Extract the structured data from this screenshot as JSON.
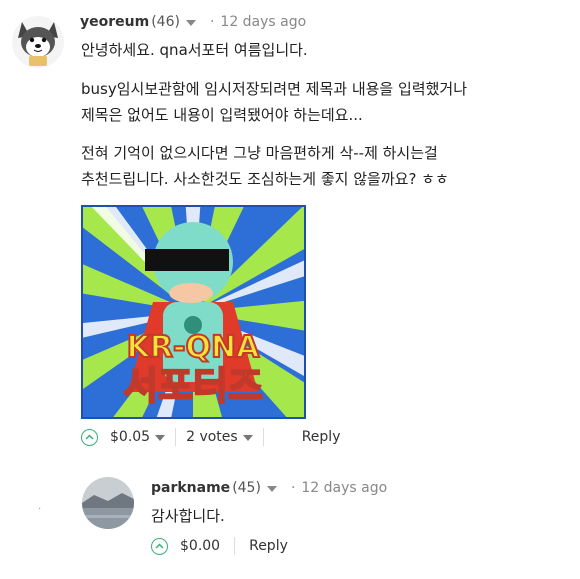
{
  "comments": [
    {
      "author": "yeoreum",
      "reputation": "(46)",
      "time": "12 days ago",
      "paragraphs": [
        "안녕하세요. qna서포터 여름입니다.",
        "busy임시보관함에 임시저장되려면 제목과 내용을 입력했거나",
        "제목은 없어도 내용이 입력됐어야 하는데요...",
        "전혀 기억이 없으시다면 그냥 마음편하게 삭--제 하시는걸",
        "추천드립니다. 사소한것도 조심하는게 좋지 않을까요? ㅎㅎ"
      ],
      "image": {
        "line1": "KR-QNA",
        "line2": "서포터즈"
      },
      "payout": "$0.05",
      "votes": "2 votes",
      "reply_label": "Reply",
      "avatar_icon": "husky-dog-icon"
    },
    {
      "author": "parkname",
      "reputation": "(45)",
      "time": "12 days ago",
      "paragraphs": [
        "감사합니다."
      ],
      "payout": "$0.00",
      "reply_label": "Reply",
      "avatar_icon": "lake-landscape-icon"
    }
  ],
  "colors": {
    "upvote": "#3ab07a",
    "image_bg": "#2d6fd6",
    "ray_green": "#a6e84b",
    "helmet": "#7fdcc9",
    "cape": "#e03a2a",
    "title_yellow": "#f6e33a"
  }
}
